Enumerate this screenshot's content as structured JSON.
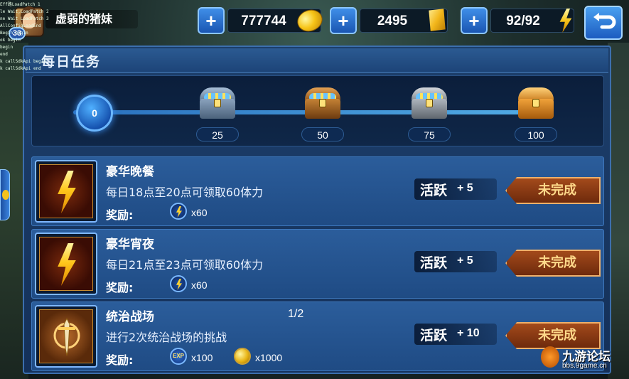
{
  "debug_log": [
    "Eff路LoadPatch 1",
    "le Wait,LoadPatch 2",
    "ne Wait LoadPatch 3",
    "AllConfigLoadEnd",
    "Begin begin",
    "ok begin",
    "begin",
    "end",
    "k callSdkApi begin",
    "k callSdkApi end"
  ],
  "player": {
    "name": "虚弱的猪妹",
    "level": "33"
  },
  "resources": {
    "coins": "777744",
    "gems": "2495",
    "energy": "92/92"
  },
  "panel": {
    "title": "每日任务"
  },
  "activity_progress": {
    "current": "0",
    "fill_fraction": 0.0,
    "milestones": [
      "25",
      "50",
      "75",
      "100"
    ]
  },
  "tasks": [
    {
      "name": "豪华晚餐",
      "progress": "",
      "desc": "每日18点至20点可领取60体力",
      "reward_label": "奖励:",
      "rewards": [
        {
          "icon": "energy-icon",
          "qty": "x60"
        }
      ],
      "activity_label": "活跃",
      "activity_value": "+ 5",
      "status": "未完成"
    },
    {
      "name": "豪华宵夜",
      "progress": "",
      "desc": "每日21点至23点可领取60体力",
      "reward_label": "奖励:",
      "rewards": [
        {
          "icon": "energy-icon",
          "qty": "x60"
        }
      ],
      "activity_label": "活跃",
      "activity_value": "+ 5",
      "status": "未完成"
    },
    {
      "name": "统治战场",
      "progress": "1/2",
      "desc": "进行2次统治战场的挑战",
      "reward_label": "奖励:",
      "rewards": [
        {
          "icon": "exp-icon",
          "icon_text": "EXP",
          "qty": "x100"
        },
        {
          "icon": "coin-icon",
          "qty": "x1000"
        }
      ],
      "activity_label": "活跃",
      "activity_value": "+ 10",
      "status": "未完成"
    }
  ],
  "watermark": {
    "title": "九游论坛",
    "url": "bbs.9game.cn"
  },
  "colors": {
    "panel": "#1d3f6b",
    "accent": "#5ec2ff",
    "status_text": "#ffd98a"
  }
}
